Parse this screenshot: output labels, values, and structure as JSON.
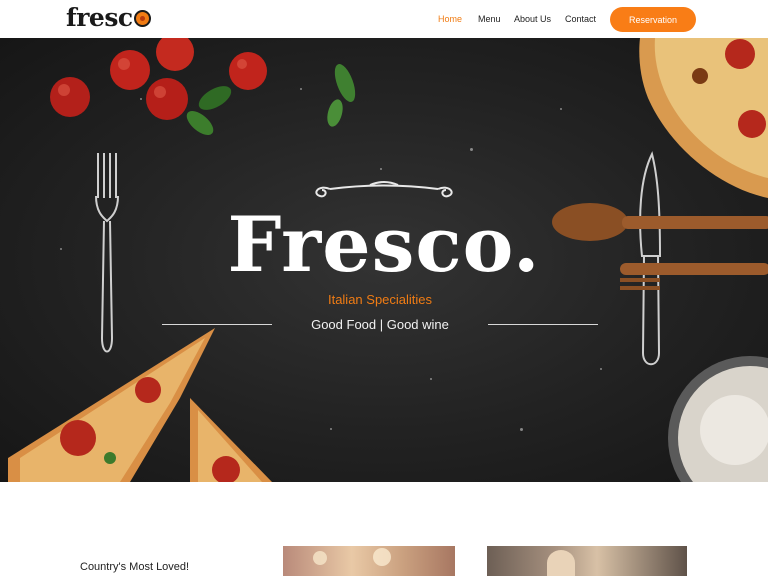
{
  "header": {
    "logo": "fresc",
    "nav": [
      {
        "label": "Home",
        "active": true
      },
      {
        "label": "Menu",
        "active": false
      },
      {
        "label": "About Us",
        "active": false
      },
      {
        "label": "Contact",
        "active": false
      }
    ],
    "cta": "Reservation"
  },
  "hero": {
    "title": "Fresco.",
    "subtitle": "Italian Specialities",
    "tagline": "Good Food | Good wine"
  },
  "section": {
    "heading": "Country's Most Loved!"
  },
  "colors": {
    "accent": "#f97d16",
    "hero_bg": "#222222"
  }
}
